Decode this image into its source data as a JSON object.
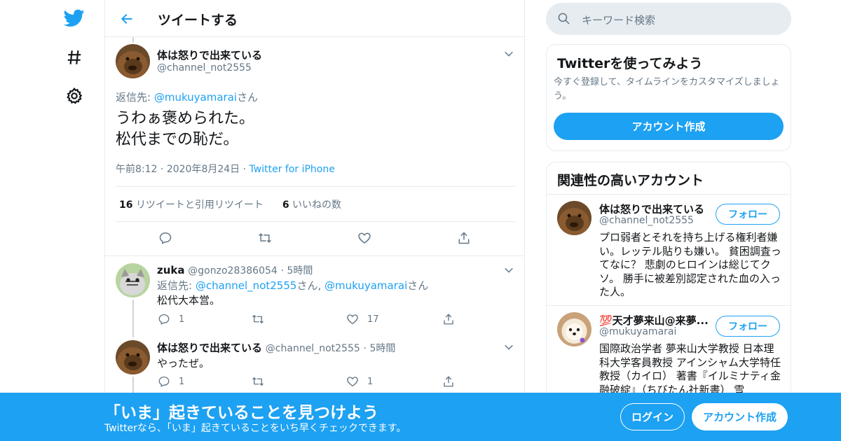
{
  "header": {
    "title": "ツイートする"
  },
  "main_tweet": {
    "name": "体は怒りで出来ている",
    "handle": "@channel_not2555",
    "reply_prefix": "返信先: ",
    "reply_to": "@mukuyamarai",
    "reply_suffix": "さん",
    "text_line1": "うわぁ褒められた。",
    "text_line2": "松代までの恥だ。",
    "time": "午前8:12",
    "date": "2020年8月24日",
    "source": "Twitter for iPhone",
    "retweets_count": "16",
    "retweets_label": "リツイートと引用リツイート",
    "likes_count": "6",
    "likes_label": "いいねの数"
  },
  "replies": [
    {
      "name": "zuka",
      "handle": "@gonzo28386054",
      "time": "5時間",
      "reply_prefix": "返信先: ",
      "reply_to_1": "@channel_not2555",
      "reply_mid": "さん, ",
      "reply_to_2": "@mukuyamarai",
      "reply_suffix": "さん",
      "text": "松代大本営。",
      "reply_count": "1",
      "like_count": "17"
    },
    {
      "name": "体は怒りで出来ている",
      "handle": "@channel_not2555",
      "time": "5時間",
      "text": "やったぜ。",
      "reply_count": "1",
      "like_count": "1"
    }
  ],
  "search": {
    "placeholder": "キーワード検索"
  },
  "signup_card": {
    "title": "Twitterを使ってみよう",
    "subtitle": "今すぐ登録して、タイムラインをカスタマイズしましょう。",
    "button": "アカウント作成"
  },
  "related": {
    "title": "関連性の高いアカウント",
    "follow_label": "フォロー",
    "accounts": [
      {
        "name": "体は怒りで出来ている",
        "handle": "@channel_not2555",
        "bio": "プロ弱者とそれを持ち上げる権利者嫌い。レッテル貼りも嫌い。 貧困調査ってなに？ 悲劇のヒロインは総じてクソ。 勝手に被差別認定された血の入った人。"
      },
      {
        "name": "💯天才夢来山@来夢...",
        "handle": "@mukuyamarai",
        "bio": "国際政治学者 夢来山大学教授 日本理科大学客員教授 アインシャム大学特任教授（カイロ） 著書『イルミナティ金融破綻』（ちびたん社新書） 雪"
      }
    ]
  },
  "banner": {
    "title": "「いま」起きていることを見つけよう",
    "subtitle": "Twitterなら、「いま」起きていることをいち早くチェックできます。",
    "login": "ログイン",
    "signup": "アカウント作成"
  },
  "colors": {
    "accent": "#1da1f2",
    "text": "#14171a",
    "muted": "#657786",
    "border": "#e6ecf0"
  }
}
